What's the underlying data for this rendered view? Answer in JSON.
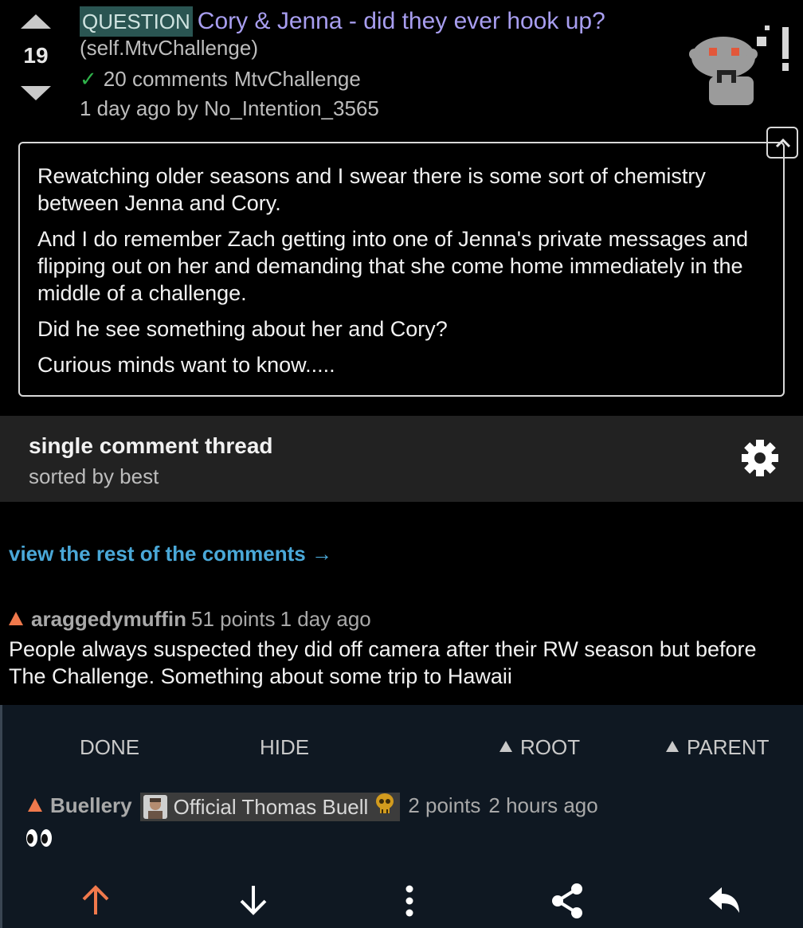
{
  "post": {
    "score": "19",
    "flair": "QUESTION",
    "title": "Cory & Jenna - did they ever hook up?",
    "domain": "(self.MtvChallenge)",
    "comments": "20 comments",
    "subreddit": "MtvChallenge",
    "submitted": "1 day ago by No_Intention_3565",
    "selftext": [
      "Rewatching older seasons and I swear there is some sort of chemistry between Jenna and Cory.",
      "And I do remember Zach getting into one of Jenna's private messages and flipping out on her and demanding that she come home immediately in the middle of a challenge.",
      "Did he see something about her and Cory?",
      "Curious minds want to know....."
    ]
  },
  "thread": {
    "title": "single comment thread",
    "sort": "sorted by best",
    "view_rest": "view the rest of the comments →"
  },
  "comments": [
    {
      "author": "araggedymuffin",
      "points": "51 points",
      "time": "1 day ago",
      "body": "People always suspected they did off camera after their RW season but before The Challenge. Something about some trip to Hawaii"
    },
    {
      "author": "Buellery",
      "flair": "Official Thomas Buell",
      "points": "2 points",
      "time": "2 hours ago",
      "body": "👀"
    }
  ],
  "actions": {
    "done": "DONE",
    "hide": "HIDE",
    "root": "ROOT",
    "parent": "PARENT"
  },
  "icons": {
    "upvote": "arrow-up-icon",
    "downvote": "arrow-down-icon",
    "more": "more-vertical-icon",
    "share": "share-icon",
    "reply": "reply-icon"
  },
  "colors": {
    "title": "#a89ef0",
    "flair_bg": "#2a5552",
    "link": "#4aa8d8",
    "upvote": "#f0794c",
    "check": "#2fb24a",
    "panel_bg": "#0f1822"
  }
}
